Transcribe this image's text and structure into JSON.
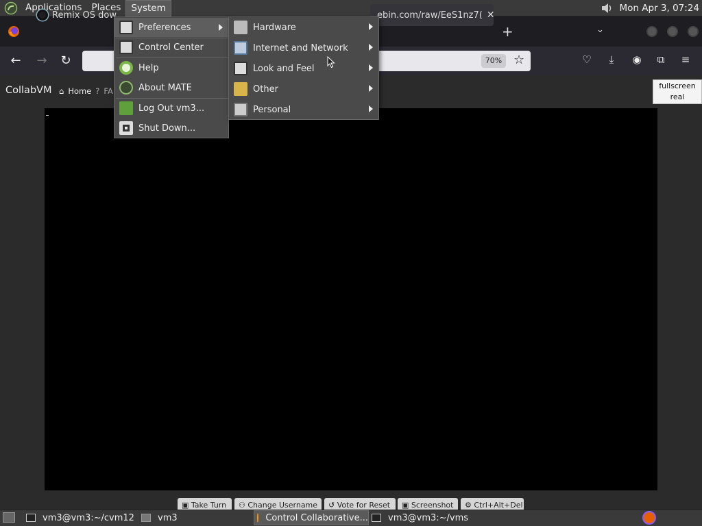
{
  "top_panel": {
    "menus": [
      "Applications",
      "Places",
      "System"
    ],
    "clock": "Mon Apr  3, 07:24"
  },
  "browser": {
    "tabs": [
      {
        "title": "Remix OS dow"
      },
      {
        "title": "ebin.com/raw/EeS1nz7("
      }
    ],
    "zoom": "70%"
  },
  "page": {
    "brand": "CollabVM",
    "nav": [
      "Home",
      "FA"
    ],
    "fullscreen_label_1": "fullscreen",
    "fullscreen_label_2": "real",
    "vm_buttons": [
      "Take Turn",
      "Change Username",
      "Vote for Reset",
      "Screenshot",
      "Ctrl+Alt+Del"
    ]
  },
  "system_menu": {
    "items": [
      "Preferences",
      "Control Center",
      "Help",
      "About MATE",
      "Log Out vm3...",
      "Shut Down..."
    ]
  },
  "preferences_submenu": {
    "items": [
      "Hardware",
      "Internet and Network",
      "Look and Feel",
      "Other",
      "Personal"
    ]
  },
  "taskbar": {
    "tasks": [
      "vm3@vm3:~/cvm12",
      "vm3",
      "Control Collaborative...",
      "vm3@vm3:~/vms"
    ]
  },
  "colors": {
    "panel": "#3a3a3a",
    "menu_bg": "#4a4a4a",
    "menu_highlight": "#5e5e5e",
    "firefox_toolbar": "#2b2a33"
  }
}
